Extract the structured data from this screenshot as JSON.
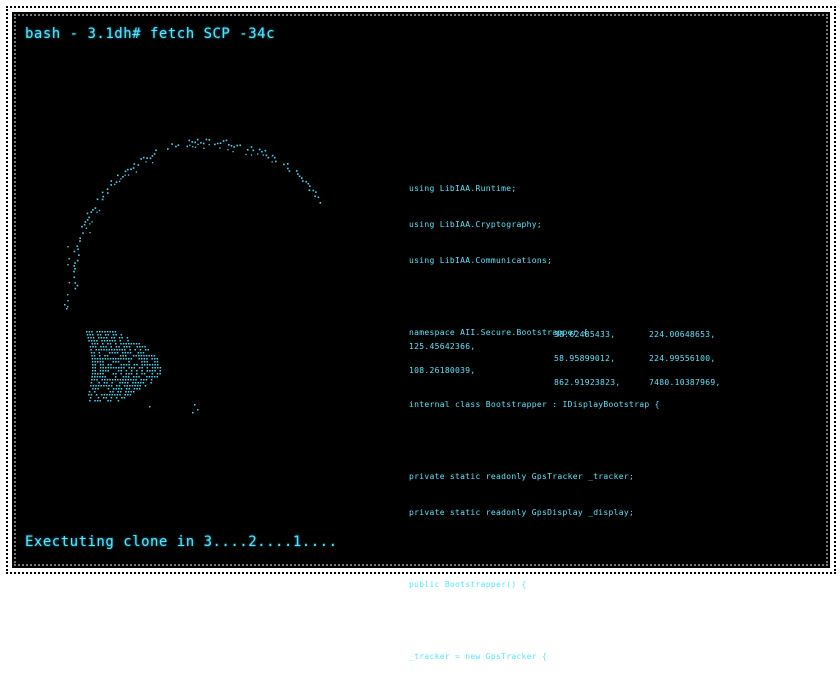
{
  "terminal": {
    "prompt": "bash - 3.1dh# fetch SCP -34c",
    "status": "Exectuting clone in 3....2....1...."
  },
  "code": {
    "lines": [
      "using LibIAA.Runtime;",
      "using LibIAA.Cryptography;",
      "using LibIAA.Communications;",
      "",
      "namespace AII.Secure.Bootstrapper {",
      "",
      "internal class Bootstrapper : IDisplayBootstrap {",
      "",
      "private static readonly GpsTracker _tracker;",
      "private static readonly GpsDisplay _display;",
      "",
      "public Bootstrapper() {",
      "",
      "_tracker = new GpsTracker {"
    ]
  },
  "coordinates": [
    {
      "a": "",
      "b": "38.62485433,",
      "c": "224.00648653,"
    },
    {
      "a": "125.45642366,",
      "b": "",
      "c": ""
    },
    {
      "a": "",
      "b": "58.95899012,",
      "c": "224.99556100,"
    },
    {
      "a": "108.26180039,",
      "b": "",
      "c": ""
    },
    {
      "a": "",
      "b": "862.91923823,",
      "c": "7480.10387969,"
    }
  ],
  "colors": {
    "background": "#000000",
    "text": "#56e6ff"
  }
}
